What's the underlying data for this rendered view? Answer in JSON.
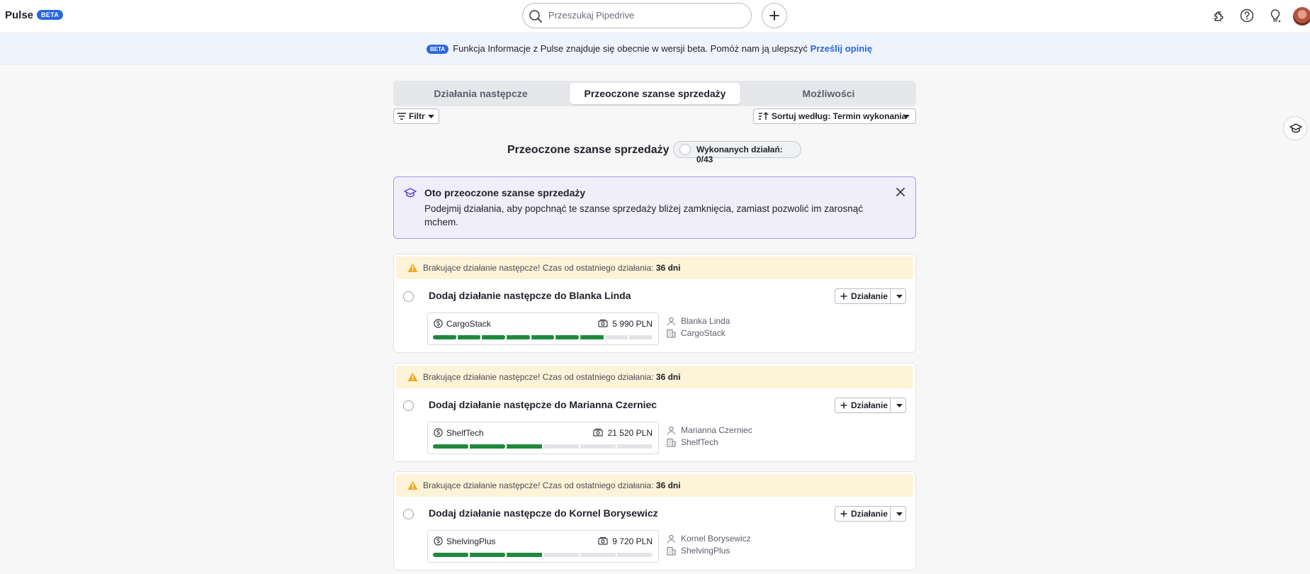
{
  "app": {
    "title": "Pulse",
    "beta_badge": "BETA"
  },
  "search": {
    "placeholder": "Przeszukaj Pipedrive"
  },
  "banner": {
    "badge": "BETA",
    "text": "Funkcja Informacje z Pulse znajduje się obecnie w wersji beta. Pomóż nam ją ulepszyć",
    "link": "Prześlij opinię"
  },
  "tabs": [
    {
      "label": "Działania następcze",
      "active": false
    },
    {
      "label": "Przeoczone szanse sprzedaży",
      "active": true
    },
    {
      "label": "Możliwości",
      "active": false
    }
  ],
  "toolbar": {
    "filter_label": "Filtr",
    "sort_label": "Sortuj według: Termin wykonania"
  },
  "section": {
    "title": "Przeoczone szanse sprzedaży",
    "done_label": "Wykonanych działań: 0/43"
  },
  "info": {
    "title": "Oto przeoczone szanse sprzedaży",
    "text": "Podejmij działania, aby popchnąć te szanse sprzedaży bliżej zamknięcia, zamiast pozwolić im zarosnąć mchem."
  },
  "deals": [
    {
      "warning": "Brakujące działanie następcze! Czas od ostatniego działania:",
      "warning_days": "36 dni",
      "title": "Dodaj działanie następcze do Blanka Linda",
      "action_label": "Działanie",
      "deal_name": "CargoStack",
      "deal_value": "5 990 PLN",
      "stages_total": 9,
      "stages_done": 7,
      "person": "Blanka Linda",
      "organization": "CargoStack"
    },
    {
      "warning": "Brakujące działanie następcze! Czas od ostatniego działania:",
      "warning_days": "36 dni",
      "title": "Dodaj działanie następcze do Marianna Czerniec",
      "action_label": "Działanie",
      "deal_name": "ShelfTech",
      "deal_value": "21 520 PLN",
      "stages_total": 6,
      "stages_done": 3,
      "person": "Marianna Czerniec",
      "organization": "ShelfTech"
    },
    {
      "warning": "Brakujące działanie następcze! Czas od ostatniego działania:",
      "warning_days": "36 dni",
      "title": "Dodaj działanie następcze do Kornel Borysewicz",
      "action_label": "Działanie",
      "deal_name": "ShelvingPlus",
      "deal_value": "9 720 PLN",
      "stages_total": 6,
      "stages_done": 3,
      "person": "Kornel Borysewicz",
      "organization": "ShelvingPlus"
    }
  ],
  "colors": {
    "accent": "#2a66e0",
    "progress": "#1f8a3d",
    "warning_bg": "#fdf3d8",
    "warning_icon": "#f2a714",
    "info_border": "#a99ae6"
  }
}
